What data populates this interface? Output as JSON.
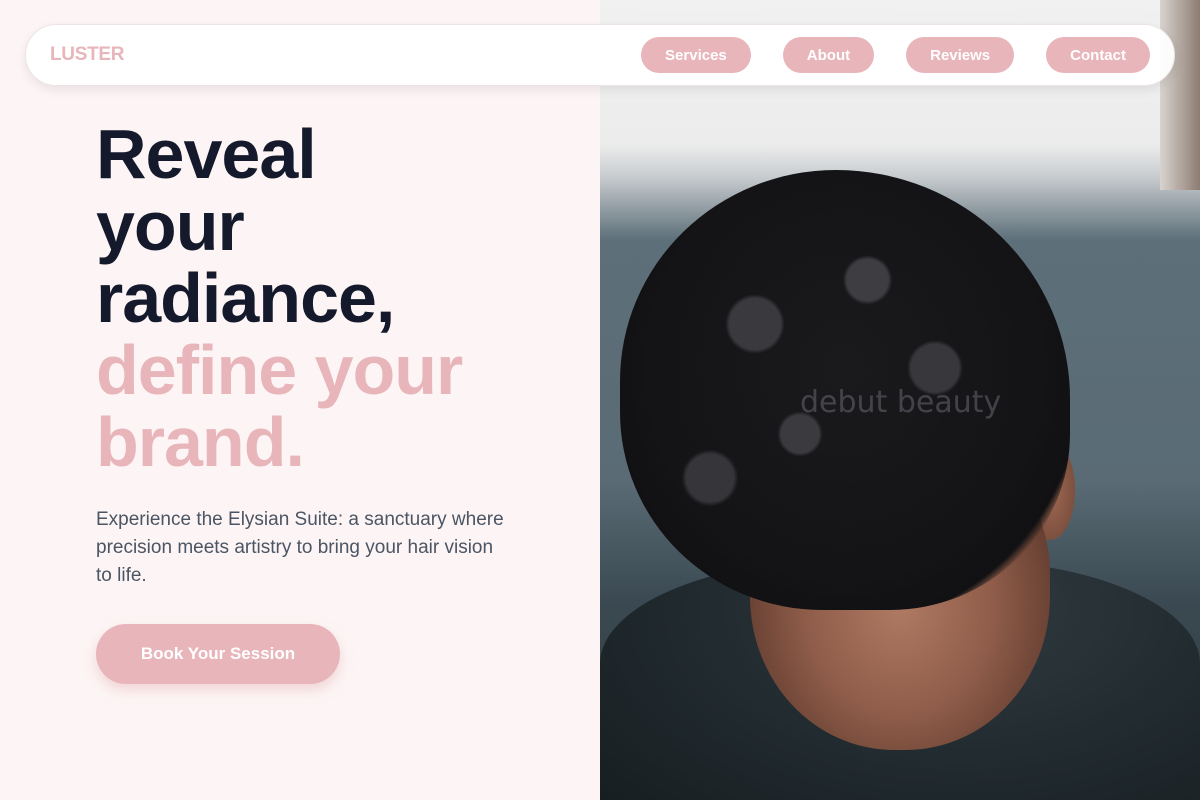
{
  "brand": {
    "logo": "LUSTER",
    "accent_color": "#e8b5ba",
    "text_color": "#141a2b"
  },
  "nav": {
    "links": [
      "Services",
      "About",
      "Reviews",
      "Contact"
    ]
  },
  "hero": {
    "headline_lines_dark": [
      "Reveal",
      "your",
      "radiance,"
    ],
    "headline_lines_pink": [
      "define your",
      "brand."
    ],
    "subtitle": "Experience the Elysian Suite: a sanctuary where precision meets artistry to bring your hair vision to life.",
    "cta_label": "Book Your Session"
  },
  "photo": {
    "watermark": "debut beauty"
  }
}
